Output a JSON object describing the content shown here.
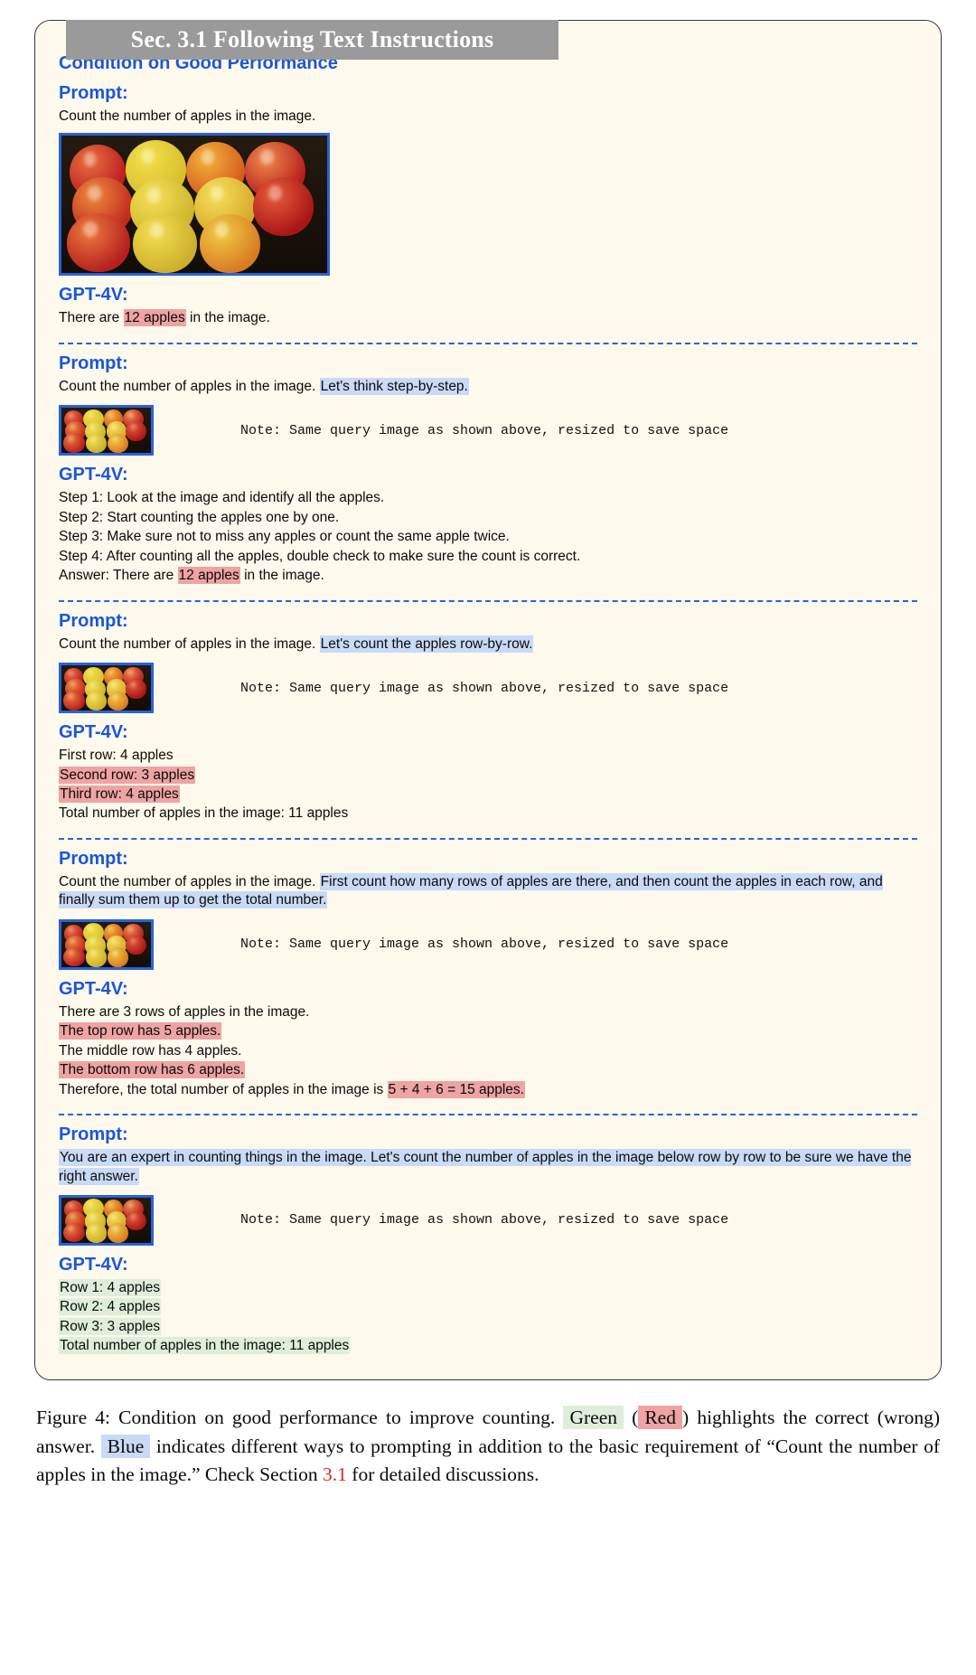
{
  "figure": {
    "title": "Sec. 3.1 Following Text Instructions",
    "section_heading": "Condition on Good Performance",
    "prompt_label": "Prompt:",
    "model_label": "GPT-4V:",
    "note": "Note: Same query image as shown above, resized to save space"
  },
  "colors": {
    "accent_blue": "#1a56d6",
    "card_bg": "#fdf9ec",
    "title_bar": "#9a9a9a",
    "highlight_blue": "#c9daf6",
    "highlight_red": "#efa3a3",
    "highlight_green": "#dfeeda",
    "divider": "#2b62d9",
    "image_border": "#2a62d8",
    "caption_link": "#d12a1e"
  },
  "blocks": [
    {
      "id": "block-1",
      "prompt": {
        "plain": "Count the number of apples in the image.",
        "highlighted": ""
      },
      "image": "apple-crate-large",
      "answer_lines": [
        {
          "pre": "There are ",
          "hl": "12 apples",
          "hl_kind": "red",
          "post": " in the image."
        }
      ]
    },
    {
      "id": "block-2",
      "prompt": {
        "plain": "Count the number of apples in the image. ",
        "highlighted": "Let's think step-by-step."
      },
      "image": "apple-crate-small",
      "answer_lines": [
        {
          "pre": "Step 1: Look at the image and identify all the apples.",
          "hl": "",
          "hl_kind": "",
          "post": ""
        },
        {
          "pre": "Step 2: Start counting the apples one by one.",
          "hl": "",
          "hl_kind": "",
          "post": ""
        },
        {
          "pre": "Step 3: Make sure not to miss any apples or count the same apple twice.",
          "hl": "",
          "hl_kind": "",
          "post": ""
        },
        {
          "pre": "Step 4: After counting all the apples, double check to make sure the count is correct.",
          "hl": "",
          "hl_kind": "",
          "post": ""
        },
        {
          "pre": "Answer: There are ",
          "hl": "12 apples",
          "hl_kind": "red",
          "post": " in the image."
        }
      ]
    },
    {
      "id": "block-3",
      "prompt": {
        "plain": "Count the number of apples in the image. ",
        "highlighted": "Let's count the apples row-by-row."
      },
      "image": "apple-crate-small",
      "answer_lines": [
        {
          "pre": "First row: 4 apples",
          "hl": "",
          "hl_kind": "",
          "post": ""
        },
        {
          "pre": "",
          "hl": "Second row: 3 apples",
          "hl_kind": "red",
          "post": ""
        },
        {
          "pre": "",
          "hl": "Third row: 4 apples",
          "hl_kind": "red",
          "post": ""
        },
        {
          "pre": "Total number of apples in the image: 11 apples",
          "hl": "",
          "hl_kind": "",
          "post": ""
        }
      ]
    },
    {
      "id": "block-4",
      "prompt": {
        "plain": "Count the number of apples in the image. ",
        "highlighted": "First count how many rows of apples are there, and then count the apples in each row, and finally sum them up to get the total number."
      },
      "image": "apple-crate-small",
      "answer_lines": [
        {
          "pre": "There are 3 rows of apples in the image.",
          "hl": "",
          "hl_kind": "",
          "post": ""
        },
        {
          "pre": "",
          "hl": "The top row has 5 apples.",
          "hl_kind": "red",
          "post": ""
        },
        {
          "pre": "The middle row has 4 apples.",
          "hl": "",
          "hl_kind": "",
          "post": ""
        },
        {
          "pre": "",
          "hl": "The bottom row has 6 apples.",
          "hl_kind": "red",
          "post": ""
        },
        {
          "pre": "Therefore, the total number of apples in the image is ",
          "hl": "5 + 4 + 6 = 15 apples.",
          "hl_kind": "red",
          "post": ""
        }
      ]
    },
    {
      "id": "block-5",
      "prompt": {
        "plain": "",
        "highlighted": "You are an expert in counting things in the image. Let's count the number of apples in the image below row by row to be sure we have the right answer."
      },
      "image": "apple-crate-small",
      "answer_lines": [
        {
          "pre": "",
          "hl": "Row 1: 4 apples",
          "hl_kind": "green",
          "post": ""
        },
        {
          "pre": "",
          "hl": "Row 2: 4 apples",
          "hl_kind": "green",
          "post": ""
        },
        {
          "pre": "",
          "hl": "Row 3: 3 apples",
          "hl_kind": "green",
          "post": ""
        },
        {
          "pre": "",
          "hl": "Total number of apples in the image: 11 apples",
          "hl_kind": "green",
          "post": ""
        }
      ]
    }
  ],
  "caption": {
    "p1": "Figure 4: Condition on good performance to improve counting.",
    "green_word": "Green",
    "paren_open": "(",
    "red_word": "Red",
    "paren_close": ")",
    "p2": "highlights the correct (wrong) answer.",
    "blue_word": "Blue",
    "p3": "indicates different ways to prompting in addition to the basic requirement of “Count the number of apples in the image.” Check Section",
    "link": "3.1",
    "p4": "for detailed discussions."
  }
}
